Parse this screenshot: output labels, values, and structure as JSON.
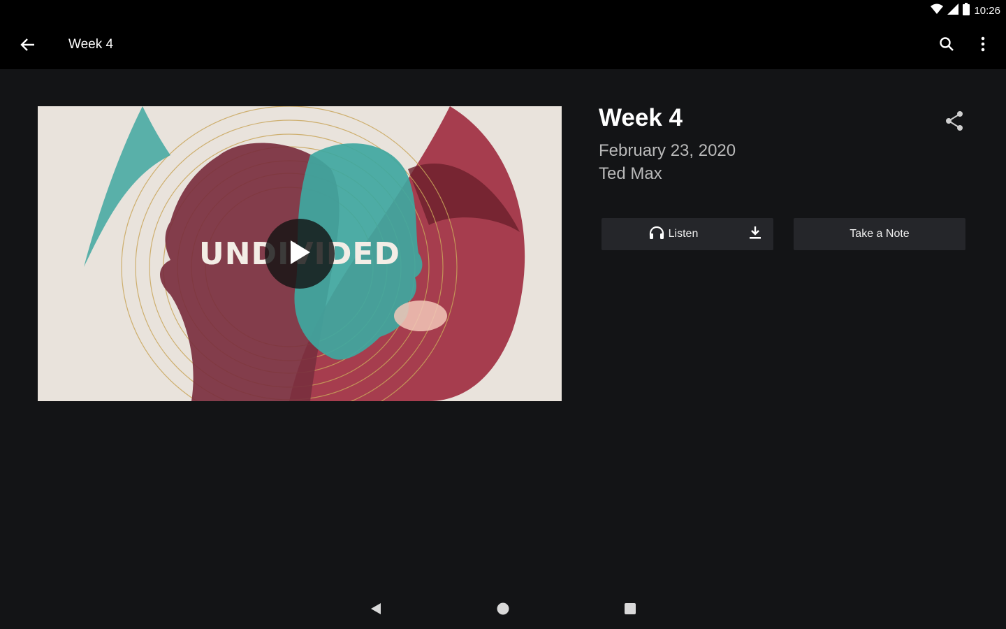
{
  "status_bar": {
    "time": "10:26",
    "icons": [
      "wifi-icon",
      "cell-signal-icon",
      "battery-icon"
    ]
  },
  "app_bar": {
    "title": "Week 4",
    "icons": [
      "arrow-back-icon",
      "search-icon",
      "more-vert-icon"
    ]
  },
  "media": {
    "art_title": "UNDIVIDED",
    "icons": [
      "play-icon"
    ]
  },
  "sermon": {
    "title": "Week 4",
    "date": "February 23, 2020",
    "speaker": "Ted Max",
    "icons": [
      "share-icon"
    ]
  },
  "actions": {
    "listen_label": "Listen",
    "take_note_label": "Take a Note",
    "icons": [
      "headphones-icon",
      "download-icon"
    ]
  },
  "nav_bar": {
    "icons": [
      "nav-back-icon",
      "nav-home-icon",
      "nav-recents-icon"
    ]
  },
  "colors": {
    "background": "#131416",
    "bars": "#000000",
    "button": "#25262a",
    "secondary_text": "#b9b9b9",
    "art_teal": "#3fa7a0",
    "art_maroon": "#7a2f3e",
    "art_crimson": "#9e2a3e",
    "art_gold": "#c9a55a"
  }
}
